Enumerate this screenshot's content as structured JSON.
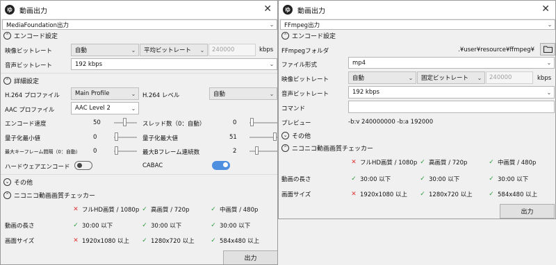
{
  "left": {
    "title": "動画出力",
    "app_icon": "ゆ",
    "profile": "MediaFoundation出力",
    "encode_header": "エンコード設定",
    "video_bitrate_label": "映像ビットレート",
    "video_bitrate_mode": "自動",
    "avg_bitrate_label": "平均ビットレート",
    "avg_bitrate_value": "240000",
    "kbps": "kbps",
    "audio_bitrate_label": "音声ビットレート",
    "audio_bitrate_value": "192 kbps",
    "detail_header": "詳細設定",
    "h264_profile_label": "H.264 プロファイル",
    "h264_profile_value": "Main Profile",
    "h264_level_label": "H.264 レベル",
    "h264_level_value": "自動",
    "aac_profile_label": "AAC プロファイル",
    "aac_profile_value": "AAC Level 2",
    "encode_speed_label": "エンコード速度",
    "encode_speed_value": "50",
    "threads_label": "スレッド数（0：自動）",
    "threads_value": "0",
    "qmin_label": "量子化最小値",
    "qmin_value": "0",
    "qmax_label": "量子化最大値",
    "qmax_value": "51",
    "keyframe_label": "最大キーフレーム間隔（0：自動）",
    "keyframe_value": "0",
    "bframes_label": "最大Bフレーム連続数",
    "bframes_value": "2",
    "hw_encode_label": "ハードウェアエンコード",
    "cabac_label": "CABAC",
    "other_header": "その他",
    "checker_header": "ニコニコ動画画質チェッカー",
    "quality_row": [
      "フルHD画質 / 1080p",
      "高画質 / 720p",
      "中画質 / 480p"
    ],
    "duration_label": "動画の長さ",
    "duration_row": [
      "30:00 以下",
      "30:00 以下",
      "30:00 以下"
    ],
    "size_label": "画面サイズ",
    "size_row": [
      "1920x1080 以上",
      "1280x720 以上",
      "584x480 以上"
    ],
    "output_button": "出力"
  },
  "right": {
    "title": "動画出力",
    "app_icon": "ゆ",
    "profile": "FFmpeg出力",
    "encode_header": "エンコード設定",
    "ffmpeg_folder_label": "FFmpegフォルダ",
    "ffmpeg_folder_value": ".¥user¥resource¥ffmpeg¥",
    "file_format_label": "ファイル形式",
    "file_format_value": "mp4",
    "video_bitrate_label": "映像ビットレート",
    "video_bitrate_mode": "自動",
    "fixed_bitrate_label": "固定ビットレート",
    "fixed_bitrate_value": "240000",
    "kbps": "kbps",
    "audio_bitrate_label": "音声ビットレート",
    "audio_bitrate_value": "192 kbps",
    "command_label": "コマンド",
    "command_value": "",
    "preview_label": "プレビュー",
    "preview_value": "-b:v 240000000 -b:a 192000",
    "other_header": "その他",
    "checker_header": "ニコニコ動画画質チェッカー",
    "quality_row": [
      "フルHD画質 / 1080p",
      "高画質 / 720p",
      "中画質 / 480p"
    ],
    "duration_label": "動画の長さ",
    "duration_row": [
      "30:00 以下",
      "30:00 以下",
      "30:00 以下"
    ],
    "size_label": "画面サイズ",
    "size_row": [
      "1920x1080 以上",
      "1280x720 以上",
      "584x480 以上"
    ],
    "output_button": "出力"
  },
  "icons": {
    "collapse": "⌃",
    "expand": "⌄",
    "dropdown": "⌄",
    "close": "✕",
    "fail": "✕",
    "pass": "✓",
    "folder": "folder-icon"
  },
  "colors": {
    "toggle_on": "#4f8fe0",
    "fail": "#d33333",
    "pass": "#2a9a3a"
  },
  "toggles": {
    "hw_encode": false,
    "cabac": true
  },
  "checker_status": {
    "left_quality": [
      "fail",
      "pass",
      "pass"
    ],
    "left_duration": [
      "pass",
      "pass",
      "pass"
    ],
    "left_size": [
      "fail",
      "pass",
      "pass"
    ],
    "right_quality": [
      "fail",
      "pass",
      "pass"
    ],
    "right_duration": [
      "pass",
      "pass",
      "pass"
    ],
    "right_size": [
      "fail",
      "pass",
      "pass"
    ]
  }
}
